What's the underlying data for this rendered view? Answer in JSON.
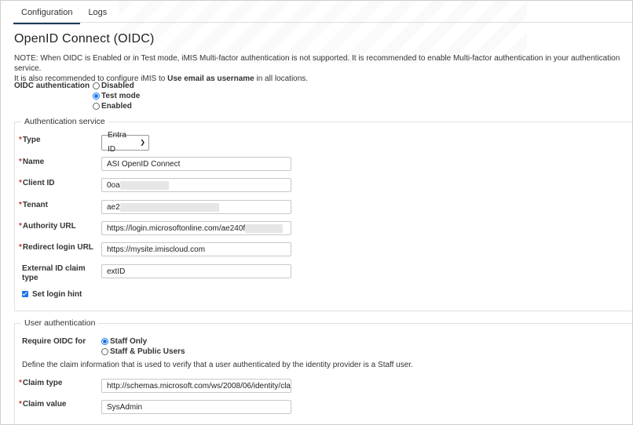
{
  "tabs": [
    {
      "label": "Configuration",
      "active": true
    },
    {
      "label": "Logs",
      "active": false
    }
  ],
  "title": "OpenID Connect (OIDC)",
  "note": {
    "line1": "NOTE: When OIDC is Enabled or in Test mode, iMIS Multi-factor authentication is not supported. It is recommended to enable Multi-factor authentication in your authentication service.",
    "line2_pre": "It is also recommended to configure iMIS to ",
    "line2_bold": "Use email as username",
    "line2_post": " in all locations."
  },
  "oidc_auth": {
    "label": "OIDC authentication",
    "options": [
      "Disabled",
      "Test mode",
      "Enabled"
    ],
    "selected": "Test mode"
  },
  "auth_service": {
    "legend": "Authentication service",
    "type_label": "Type",
    "type_value": "Entra ID",
    "name_label": "Name",
    "name_value": "ASI OpenID Connect",
    "client_id_label": "Client ID",
    "client_id_value": "0oa",
    "tenant_label": "Tenant",
    "tenant_value": "ae2",
    "authority_url_label": "Authority URL",
    "authority_url_value": "https://login.microsoftonline.com/ae240f",
    "redirect_label": "Redirect login URL",
    "redirect_value": "https://mysite.imiscloud.com",
    "ext_id_label_1": "External ID claim",
    "ext_id_label_2": "type",
    "ext_id_value": "extID",
    "login_hint_label": "Set login hint",
    "login_hint_checked": true
  },
  "user_auth": {
    "legend": "User authentication",
    "require_label": "Require OIDC for",
    "options": [
      "Staff Only",
      "Staff & Public Users"
    ],
    "selected": "Staff Only",
    "define_text": "Define the claim information that is used to verify that a user authenticated by the identity provider is a Staff user.",
    "claim_type_label": "Claim type",
    "claim_type_value": "http://schemas.microsoft.com/ws/2008/06/identity/cla",
    "claim_value_label": "Claim value",
    "claim_value_value": "SysAdmin"
  },
  "colors": {
    "accent": "#1a73e8",
    "required": "#c0392b",
    "tab_underline": "#1f3b57"
  }
}
